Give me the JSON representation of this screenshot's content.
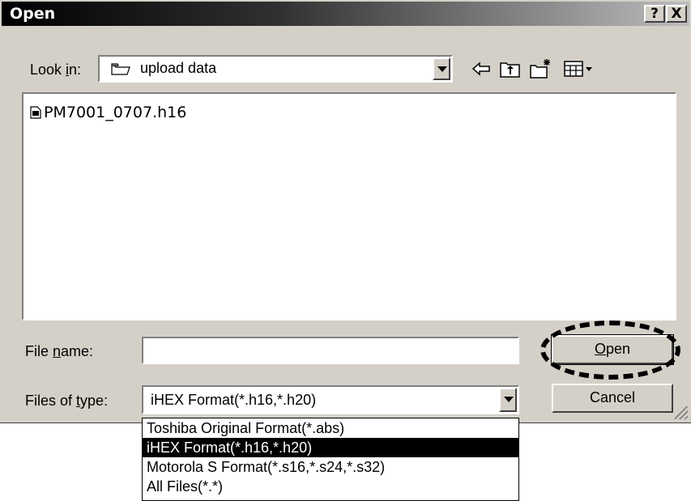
{
  "window": {
    "title": "Open",
    "help_btn": "?",
    "close_btn": "X"
  },
  "lookin": {
    "label_pre": "Look ",
    "label_u": "i",
    "label_post": "n:",
    "value": "upload data"
  },
  "toolbar": {
    "back_icon": "back-arrow-icon",
    "up_icon": "up-one-level-icon",
    "newfolder_icon": "new-folder-icon",
    "view_icon": "view-menu-icon"
  },
  "files": [
    {
      "name": "PM7001_0707.h16",
      "icon": "file-icon"
    }
  ],
  "filename": {
    "label_pre": "File ",
    "label_u": "n",
    "label_post": "ame:",
    "value": ""
  },
  "filetype": {
    "label_pre": "Files of ",
    "label_u": "t",
    "label_post": "ype:",
    "value": "iHEX Format(*.h16,*.h20)",
    "options": [
      "Toshiba Original Format(*.abs)",
      "iHEX Format(*.h16,*.h20)",
      "Motorola S Format(*.s16,*.s24,*.s32)",
      "All Files(*.*)"
    ],
    "selected_index": 1
  },
  "buttons": {
    "open_u": "O",
    "open_rest": "pen",
    "cancel": "Cancel"
  }
}
